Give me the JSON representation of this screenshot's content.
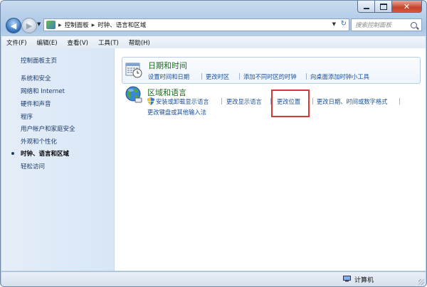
{
  "window": {
    "controls": {
      "minimize": "–",
      "maximize": "□",
      "close": "✕"
    }
  },
  "navigation": {
    "back_glyph": "◀",
    "forward_glyph": "▶",
    "dropdown_glyph": "▼"
  },
  "address": {
    "breadcrumbs": [
      "控制面板",
      "时钟、语言和区域"
    ],
    "separator": "▶",
    "dropdown_glyph": "▼",
    "refresh_glyph": "↻"
  },
  "search": {
    "placeholder": "搜索控制面板"
  },
  "menubar": {
    "items": [
      "文件(F)",
      "编辑(E)",
      "查看(V)",
      "工具(T)",
      "帮助(H)"
    ]
  },
  "sidebar": {
    "home": "控制面板主页",
    "items": [
      "系统和安全",
      "网络和 Internet",
      "硬件和声音",
      "程序",
      "用户帐户和家庭安全",
      "外观和个性化",
      "时钟、语言和区域",
      "轻松访问"
    ],
    "current_index": 6
  },
  "categories": {
    "datetime": {
      "title": "日期和时间",
      "links": [
        "设置时间和日期",
        "更改时区",
        "添加不同时区的时钟",
        "向桌面添加时钟小工具"
      ]
    },
    "region": {
      "title": "区域和语言",
      "links": [
        "安装或卸载显示语言",
        "更改显示语言",
        "更改位置",
        "更改日期、时间或数字格式",
        "更改键盘或其他输入法"
      ]
    }
  },
  "status": {
    "text": "计算机"
  },
  "colors": {
    "highlight_box": "#d43a35",
    "link": "#1a4f9c",
    "category_title": "#1e6a1e"
  }
}
